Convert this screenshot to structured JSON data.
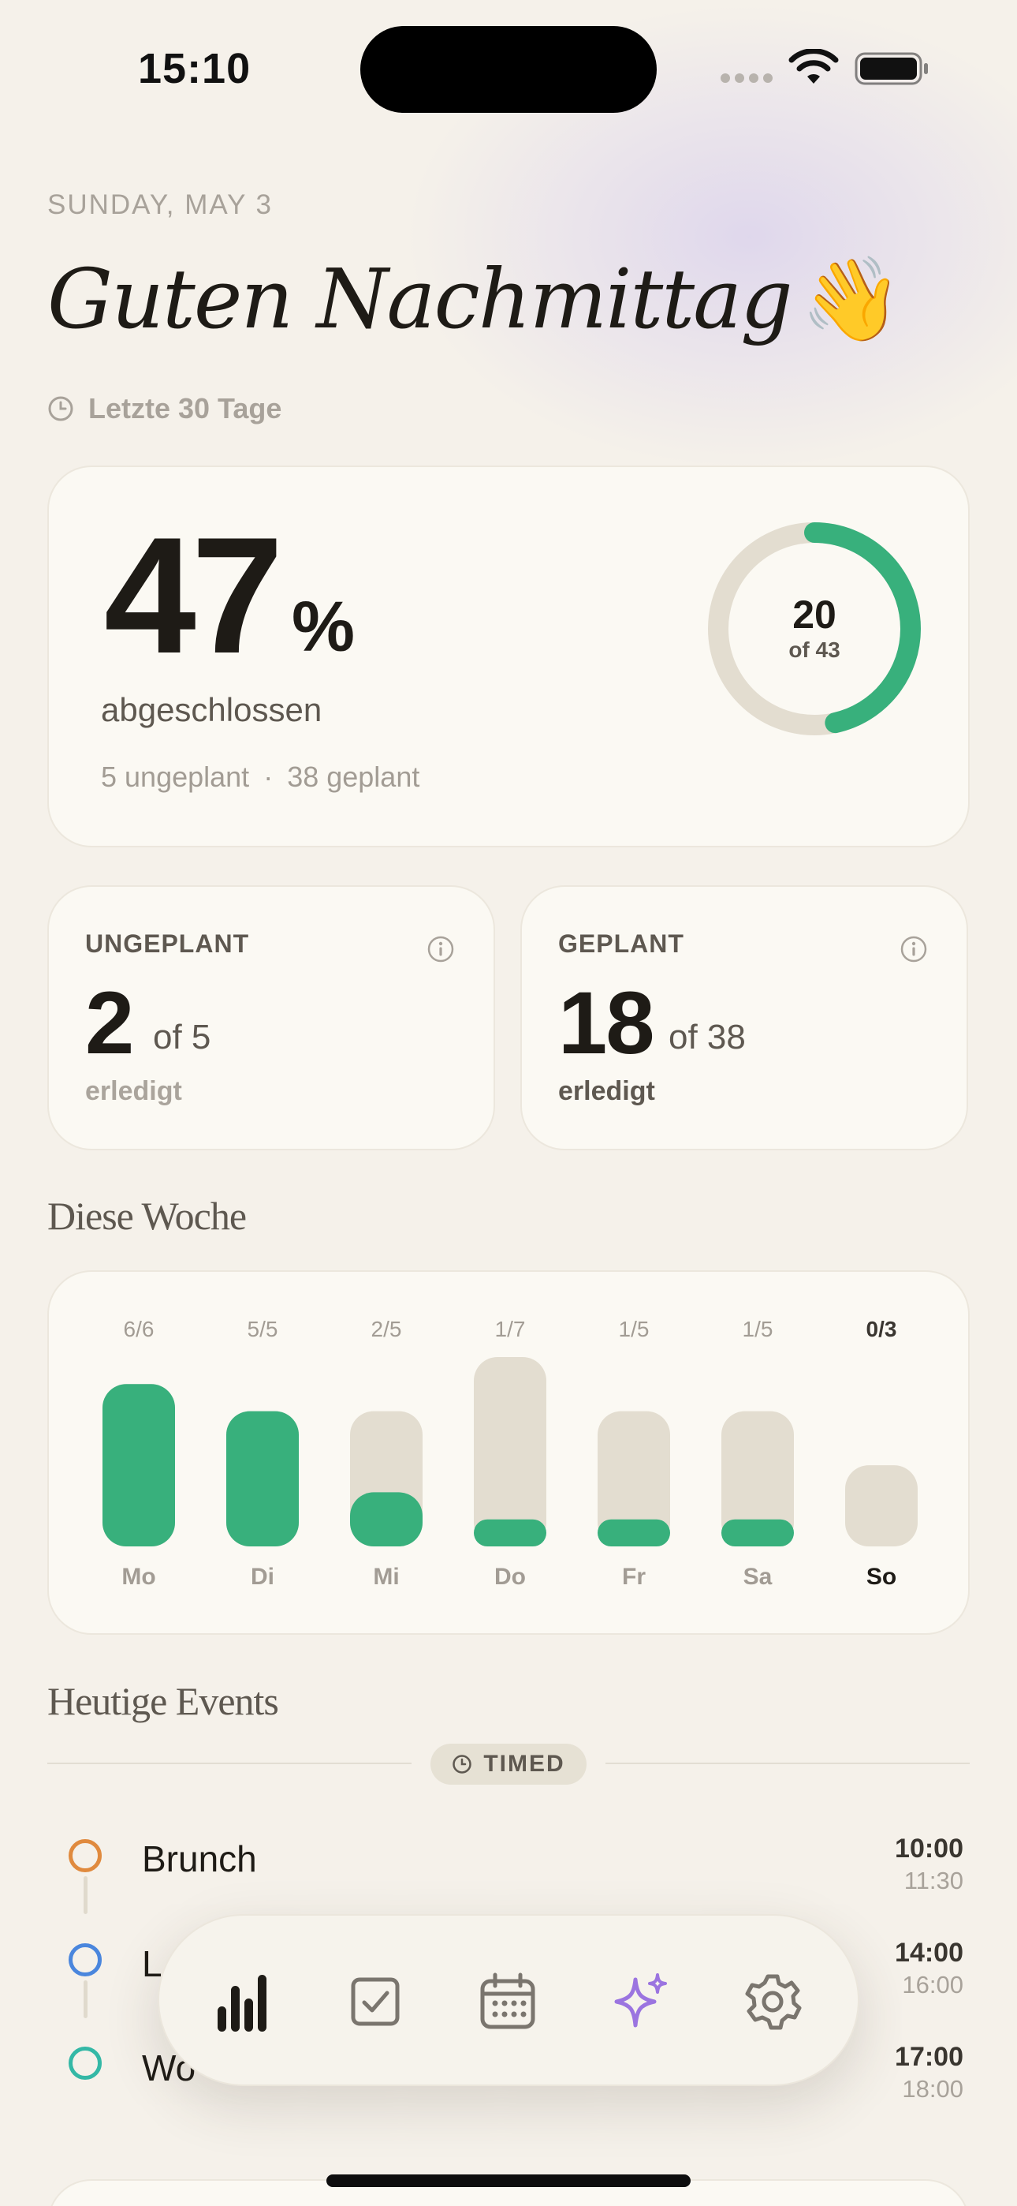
{
  "status": {
    "time": "15:10"
  },
  "header": {
    "date": "SUNDAY, MAY 3",
    "greeting": "Guten Nachmittag",
    "greeting_emoji": "👋",
    "period": "Letzte 30 Tage"
  },
  "summary": {
    "percent": "47",
    "percent_sign": "%",
    "label": "abgeschlossen",
    "unplanned_text": "5 ungeplant",
    "separator": "·",
    "planned_text": "38 geplant",
    "ring_value": "20",
    "ring_total_text": "of 43",
    "ring_done": 20,
    "ring_total": 43
  },
  "unplanned": {
    "title": "UNGEPLANT",
    "value": "2",
    "of_text": "of 5",
    "footer": "erledigt"
  },
  "planned": {
    "title": "GEPLANT",
    "value": "18",
    "of_text": "of 38",
    "footer": "erledigt"
  },
  "week": {
    "title": "Diese Woche",
    "chart_data": {
      "type": "bar",
      "categories": [
        "Mo",
        "Di",
        "Mi",
        "Do",
        "Fr",
        "Sa",
        "So"
      ],
      "done": [
        6,
        5,
        2,
        1,
        1,
        1,
        0
      ],
      "total": [
        6,
        5,
        5,
        7,
        5,
        5,
        3
      ],
      "labels": [
        "6/6",
        "5/5",
        "2/5",
        "1/7",
        "1/5",
        "1/5",
        "0/3"
      ],
      "highlight_index": 6,
      "colors": {
        "done": "#38b07c",
        "remaining": "#e3ddd0"
      }
    }
  },
  "events": {
    "title": "Heutige Events",
    "chip_label": "TIMED",
    "items": [
      {
        "name": "Brunch",
        "start": "10:00",
        "end": "11:30",
        "color": "#e08a3e"
      },
      {
        "name": "L",
        "start": "14:00",
        "end": "16:00",
        "color": "#4a86dd"
      },
      {
        "name": "Wo",
        "start": "17:00",
        "end": "18:00",
        "color": "#34b8a6"
      }
    ]
  },
  "tabbar": {
    "tabs": [
      {
        "icon": "bar-chart-icon",
        "active": true
      },
      {
        "icon": "checkbox-icon",
        "active": false
      },
      {
        "icon": "calendar-icon",
        "active": false
      },
      {
        "icon": "sparkles-icon",
        "active": false,
        "color": "#9b74e0"
      },
      {
        "icon": "gear-icon",
        "active": false
      }
    ]
  }
}
